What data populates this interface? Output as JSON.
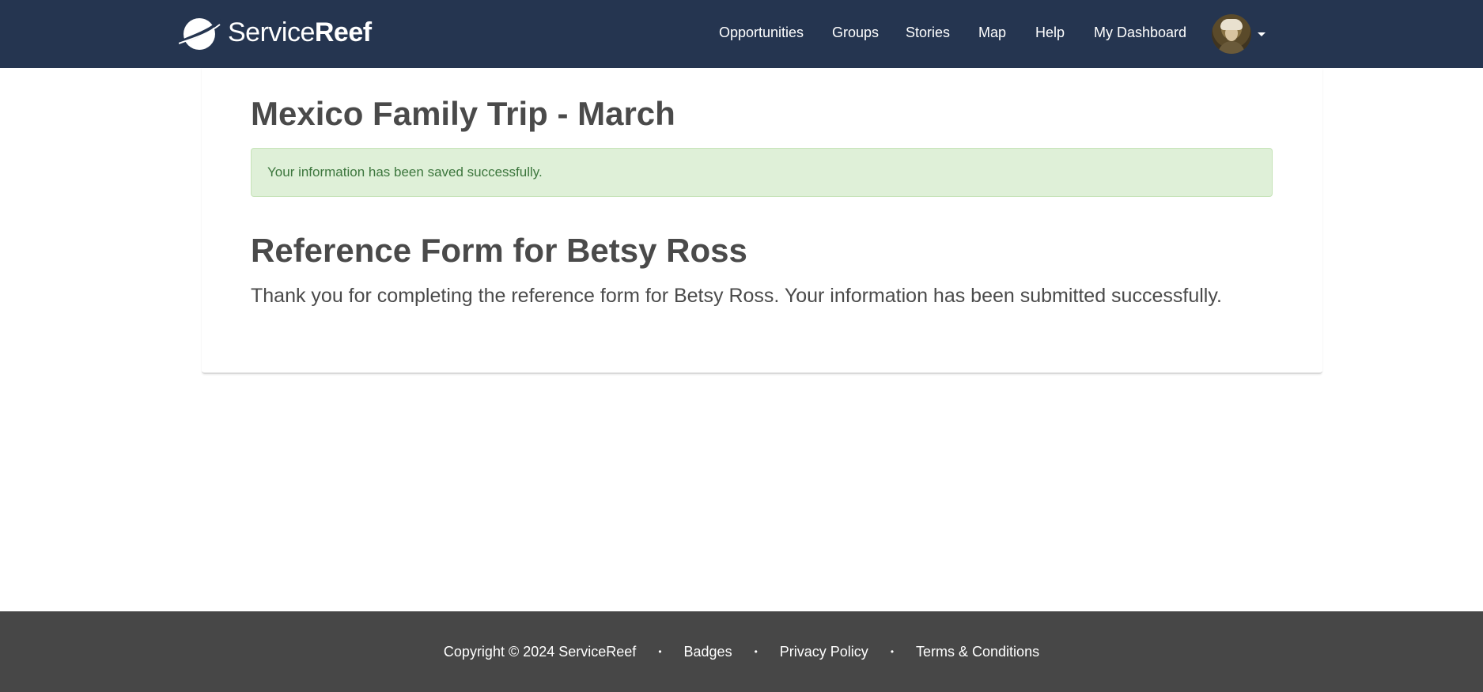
{
  "header": {
    "logo": {
      "text_thin": "Service",
      "text_bold": "Reef"
    },
    "nav": [
      {
        "label": "Opportunities"
      },
      {
        "label": "Groups"
      },
      {
        "label": "Stories"
      },
      {
        "label": "Map"
      },
      {
        "label": "Help"
      },
      {
        "label": "My Dashboard"
      }
    ],
    "avatar_icon": "user-avatar",
    "menu_icon": "caret-down-icon"
  },
  "main": {
    "page_title": "Mexico Family Trip - March",
    "alert_message": "Your information has been saved successfully.",
    "form_title": "Reference Form for Betsy Ross",
    "form_message": "Thank you for completing the reference form for Betsy Ross. Your information has been submitted successfully."
  },
  "footer": {
    "copyright": "Copyright © 2024 ServiceReef",
    "separator": "•",
    "links": [
      {
        "label": "Badges"
      },
      {
        "label": "Privacy Policy"
      },
      {
        "label": "Terms & Conditions"
      }
    ]
  },
  "colors": {
    "header_bg": "#253550",
    "footer_bg": "#474747",
    "alert_bg": "#dff0d8",
    "alert_text": "#3c763d",
    "heading_text": "#4a4a4a"
  }
}
